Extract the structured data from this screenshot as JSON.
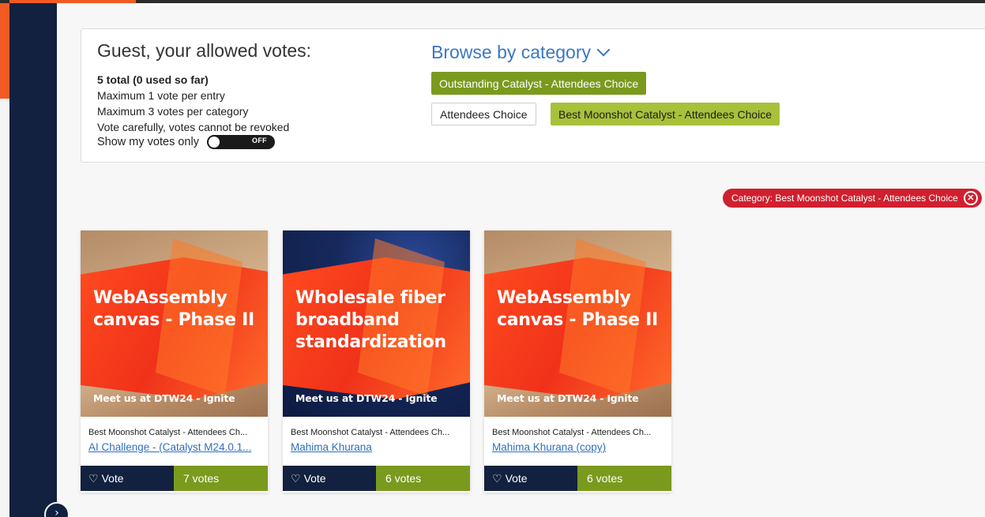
{
  "panel": {
    "title": "Guest, your allowed votes:",
    "total": "5 total (0 used so far)",
    "rules": [
      "Maximum 1 vote per entry",
      "Maximum 3 votes per category",
      "Vote carefully, votes cannot be revoked"
    ],
    "show_votes_label": "Show my votes only",
    "toggle_state": "OFF"
  },
  "browse": {
    "label": "Browse by category",
    "categories": [
      "Outstanding Catalyst - Attendees Choice",
      "Attendees Choice",
      "Best Moonshot Catalyst - Attendees Choice"
    ]
  },
  "filter": {
    "label": "Category: Best Moonshot Catalyst - Attendees Choice"
  },
  "cards": [
    {
      "headline": "WebAssembly canvas - Phase II",
      "meet": "Meet us at DTW24 - Ignite",
      "category": "Best Moonshot Catalyst - Attendees Ch...",
      "title": "AI Challenge - (Catalyst M24.0.1...",
      "vote_label": "Vote",
      "votes": "7 votes"
    },
    {
      "headline": "Wholesale fiber broadband standardization",
      "meet": "Meet us at DTW24 - Ignite",
      "category": "Best Moonshot Catalyst - Attendees Ch...",
      "title": "Mahima Khurana",
      "vote_label": "Vote",
      "votes": "6 votes"
    },
    {
      "headline": "WebAssembly canvas - Phase II",
      "meet": "Meet us at DTW24 - Ignite",
      "category": "Best Moonshot Catalyst - Attendees Ch...",
      "title": "Mahima Khurana (copy)",
      "vote_label": "Vote",
      "votes": "6 votes"
    }
  ],
  "colors": {
    "navy": "#12213f",
    "green": "#7a9a1e",
    "light_green": "#a7c13a",
    "link_blue": "#3a78c2",
    "filter_red": "#d0202f",
    "brand_orange": "#f15a22"
  }
}
